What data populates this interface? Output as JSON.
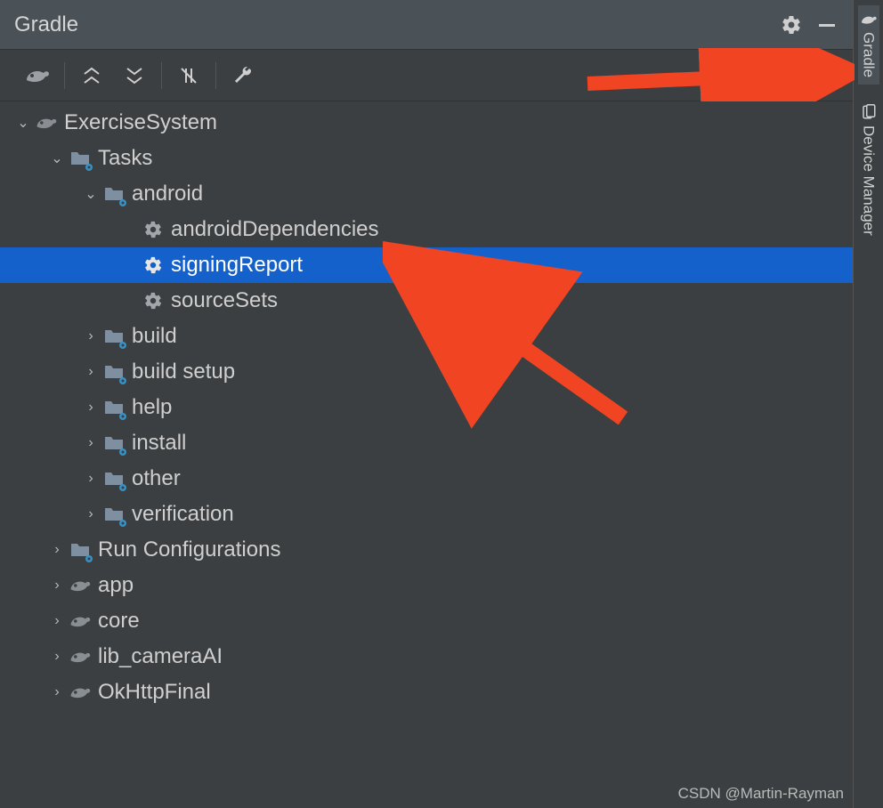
{
  "panel": {
    "title": "Gradle"
  },
  "right_rail": {
    "tabs": [
      {
        "label": "Gradle"
      },
      {
        "label": "Device Manager"
      }
    ]
  },
  "tree": {
    "root": {
      "label": "ExerciseSystem",
      "children": [
        {
          "label": "Tasks",
          "children": [
            {
              "label": "android",
              "expanded": true,
              "tasks": [
                {
                  "label": "androidDependencies"
                },
                {
                  "label": "signingReport",
                  "selected": true
                },
                {
                  "label": "sourceSets"
                }
              ]
            },
            {
              "label": "build"
            },
            {
              "label": "build setup"
            },
            {
              "label": "help"
            },
            {
              "label": "install"
            },
            {
              "label": "other"
            },
            {
              "label": "verification"
            }
          ]
        },
        {
          "label": "Run Configurations"
        },
        {
          "label": "app"
        },
        {
          "label": "core"
        },
        {
          "label": "lib_cameraAI"
        },
        {
          "label": "OkHttpFinal"
        }
      ]
    }
  },
  "watermark": "CSDN @Martin-Rayman"
}
